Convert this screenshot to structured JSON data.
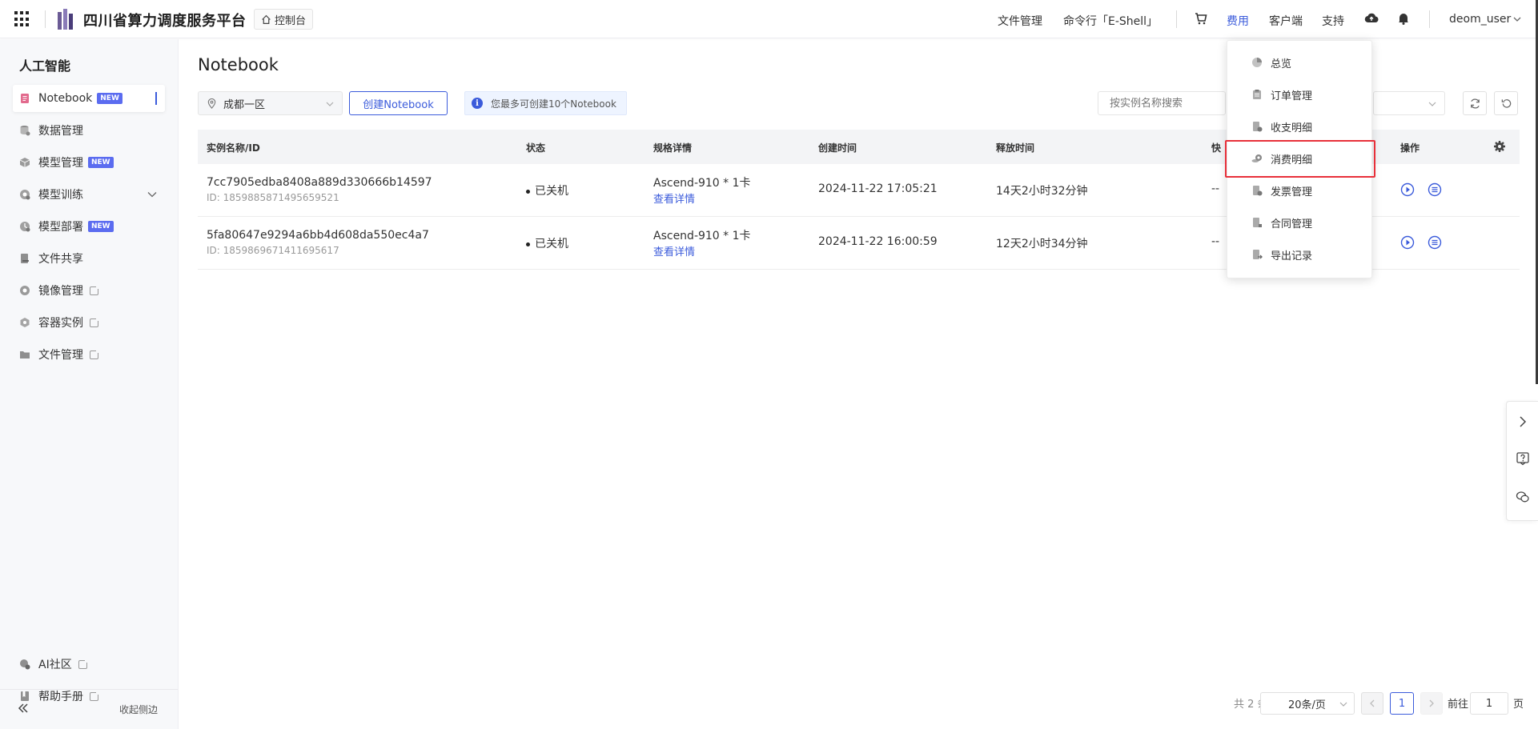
{
  "header": {
    "brand": "四川省算力调度服务平台",
    "console_label": "控制台",
    "nav": {
      "file_mgmt": "文件管理",
      "eshell": "命令行「E-Shell」",
      "billing": "费用",
      "client": "客户端",
      "support": "支持",
      "user": "deom_user"
    },
    "icons": [
      "apps-grid-icon",
      "cart-icon",
      "cloud-upload-icon",
      "bell-icon",
      "chevron-down-icon"
    ]
  },
  "sidebar": {
    "title": "人工智能",
    "items": [
      {
        "label": "Notebook",
        "badge": "NEW",
        "active": true
      },
      {
        "label": "数据管理"
      },
      {
        "label": "模型管理",
        "badge": "NEW"
      },
      {
        "label": "模型训练"
      },
      {
        "label": "模型部署",
        "badge": "NEW"
      },
      {
        "label": "文件共享"
      },
      {
        "label": "镜像管理"
      },
      {
        "label": "容器实例"
      },
      {
        "label": "文件管理"
      }
    ],
    "bottom": {
      "community": "AI社区",
      "manual": "帮助手册",
      "collapse": "收起侧边"
    }
  },
  "main": {
    "title": "Notebook",
    "region": "成都一区",
    "create_label": "创建Notebook",
    "tip": "您最多可创建10个Notebook",
    "search_placeholder": "按实例名称搜索",
    "columns": {
      "name": "实例名称/ID",
      "status": "状态",
      "spec": "规格详情",
      "created": "创建时间",
      "release": "释放时间",
      "snapshot": "快",
      "ops": "操作"
    },
    "rows": [
      {
        "name": "7cc7905edba8408a889d330666b14597",
        "id": "ID: 1859885871495659521",
        "status": "已关机",
        "spec": "Ascend-910 * 1卡",
        "spec_link": "查看详情",
        "created": "2024-11-22 17:05:21",
        "release": "14天2小时32分钟",
        "snapshot": "--"
      },
      {
        "name": "5fa80647e9294a6bb4d608da550ec4a7",
        "id": "ID: 1859869671411695617",
        "status": "已关机",
        "spec": "Ascend-910 * 1卡",
        "spec_link": "查看详情",
        "created": "2024-11-22 16:00:59",
        "release": "12天2小时34分钟",
        "snapshot": "--"
      }
    ]
  },
  "pagination": {
    "total": "共 2 条",
    "page_size": "20条/页",
    "current": "1",
    "goto_prefix": "前往",
    "goto_value": "1",
    "goto_suffix": "页"
  },
  "billing_menu": {
    "items": [
      {
        "label": "总览",
        "icon": "pie-chart-icon"
      },
      {
        "label": "订单管理",
        "icon": "clipboard-icon"
      },
      {
        "label": "收支明细",
        "icon": "receipt-icon"
      },
      {
        "label": "消费明细",
        "icon": "coins-icon",
        "highlighted": true
      },
      {
        "label": "发票管理",
        "icon": "invoice-icon"
      },
      {
        "label": "合同管理",
        "icon": "contract-icon"
      },
      {
        "label": "导出记录",
        "icon": "export-icon"
      }
    ]
  },
  "colors": {
    "accent": "#3b5bdb",
    "highlight": "#e8303a",
    "badge": "#5b6cf0"
  }
}
